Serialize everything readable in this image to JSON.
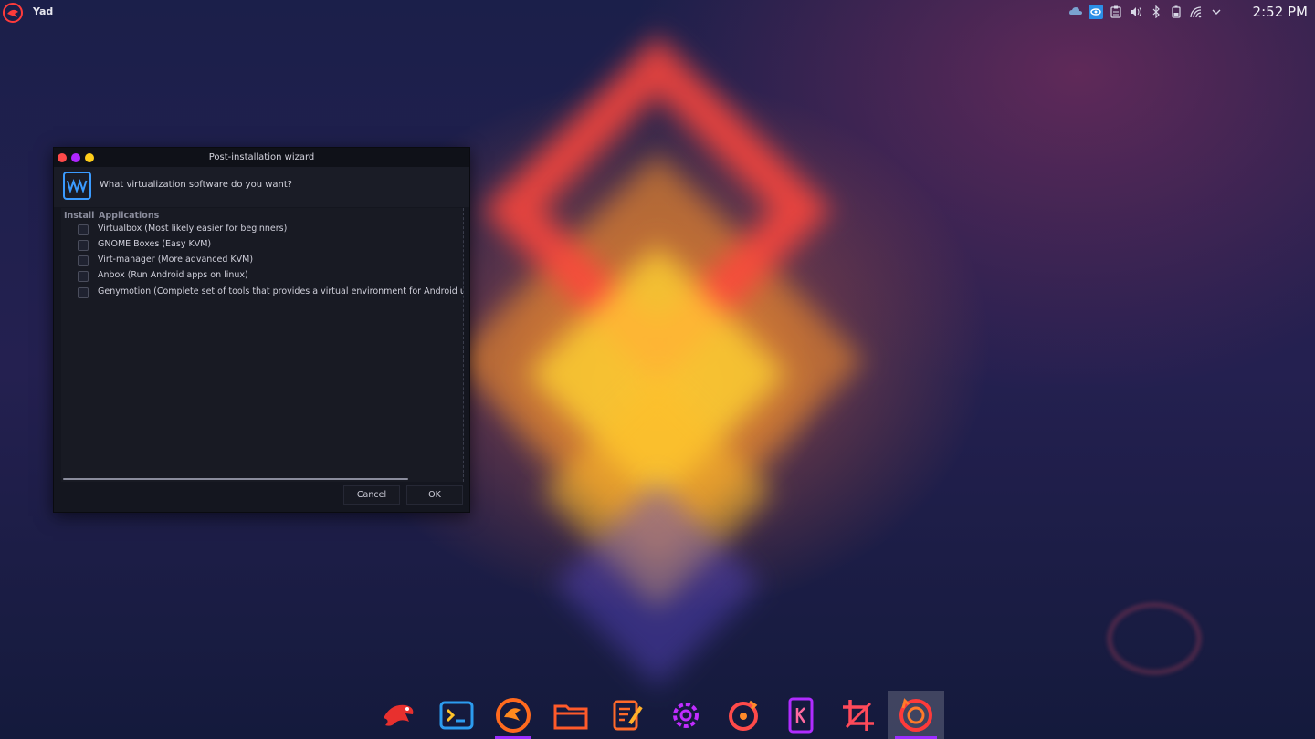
{
  "topbar": {
    "app_name": "Yad",
    "clock": "2:52 PM",
    "tray_icons": [
      "weather-icon",
      "eye-icon",
      "clipboard-icon",
      "volume-icon",
      "bluetooth-icon",
      "battery-icon",
      "wifi-icon",
      "chevron-down-icon"
    ]
  },
  "window": {
    "title": "Post-installation wizard",
    "question": "What virtualization software do you want?",
    "columns": {
      "install": "Install",
      "applications": "Applications"
    },
    "rows": [
      {
        "label": "Virtualbox (Most likely easier for beginners)",
        "checked": false
      },
      {
        "label": "GNOME Boxes (Easy KVM)",
        "checked": false
      },
      {
        "label": "Virt-manager (More advanced KVM)",
        "checked": false
      },
      {
        "label": "Anbox (Run Android apps on linux)",
        "checked": false
      },
      {
        "label": "Genymotion (Complete set of tools that provides a virtual environment for Android usi",
        "checked": false
      }
    ],
    "buttons": {
      "cancel": "Cancel",
      "ok": "OK"
    }
  },
  "dock": {
    "items": [
      "garuda-icon",
      "terminal-icon",
      "firedragon-icon",
      "folder-icon",
      "text-editor-icon",
      "settings-icon",
      "music-icon",
      "kdeconnect-icon",
      "crop-icon",
      "timeshift-icon"
    ],
    "accent": "#9b2cff"
  },
  "colors": {
    "window_bg": "#14161f",
    "accent_orange": "#ff5a3c",
    "accent_purple": "#b026ff"
  }
}
